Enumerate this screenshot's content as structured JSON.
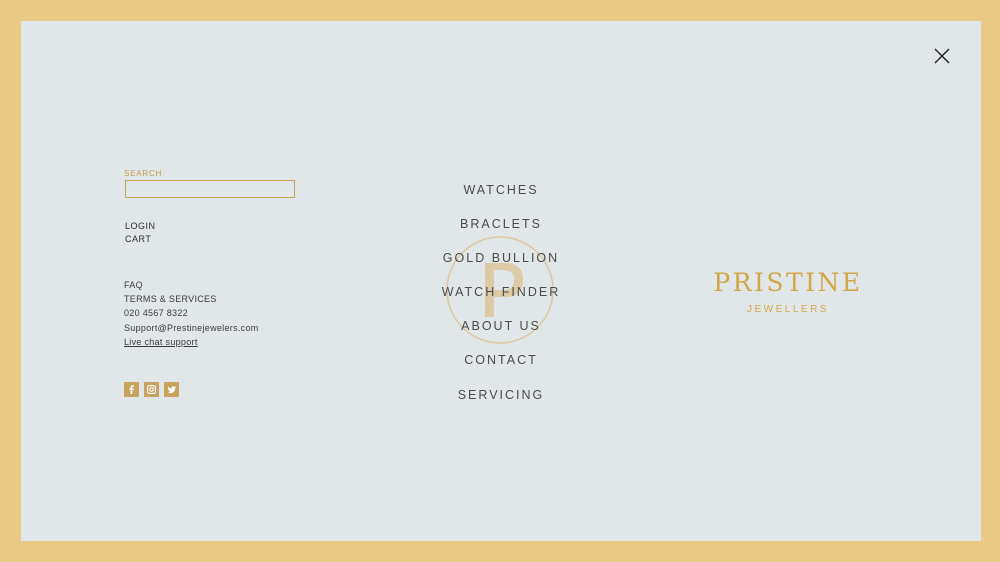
{
  "search": {
    "label": "SEARCH",
    "value": "",
    "placeholder": ""
  },
  "account": {
    "login": "LOGIN",
    "cart": "CART"
  },
  "info": {
    "faq": "FAQ",
    "terms": "TERMS & SERVICES",
    "phone": "020 4567 8322",
    "email": "Support@Prestinejewelers.com",
    "live_chat": "Live chat support"
  },
  "social": [
    "facebook-icon",
    "instagram-icon",
    "twitter-icon"
  ],
  "nav": {
    "items": [
      {
        "label": "WATCHES"
      },
      {
        "label": "BRACLETS"
      },
      {
        "label": "GOLD BULLION"
      },
      {
        "label": "WATCH FINDER"
      },
      {
        "label": "ABOUT US"
      },
      {
        "label": "CONTACT"
      },
      {
        "label": "SERVICING"
      }
    ]
  },
  "brand": {
    "name": "PRISTINE",
    "subtitle": "JEWELLERS"
  },
  "colors": {
    "frame": "#e8ca86",
    "panel": "#e1e7e8",
    "accent": "#c9a25f",
    "text": "#4a4a4a"
  }
}
